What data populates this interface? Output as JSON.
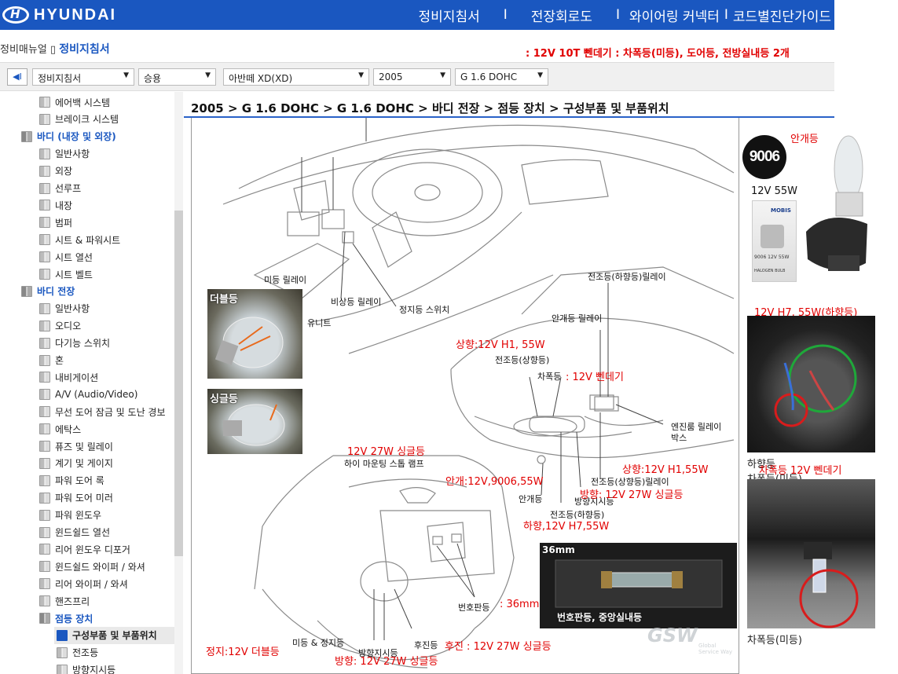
{
  "header": {
    "brand": "HYUNDAI",
    "nav": [
      "정비지침서",
      "전장회로도",
      "와이어링 커넥터",
      "코드별진단가이드"
    ],
    "separators": [
      "I",
      "I",
      "I"
    ]
  },
  "breadcrumb": {
    "prefix": "정비매뉴얼 ▯",
    "current": "정비지침서"
  },
  "notice": ": 12V 10T 뻰데기 : 차폭등(미등), 도어등, 전방실내등  2개",
  "filters": {
    "back_icon": "◀I",
    "manual": "정비지침서",
    "category": "승용",
    "model": "아반떼 XD(XD)",
    "year": "2005",
    "engine": "G 1.6 DOHC"
  },
  "sidebar": {
    "items": [
      {
        "label": "에어백 시스템",
        "level": 1
      },
      {
        "label": "브레이크 시스템",
        "level": 1
      },
      {
        "label": "바디 (내장 및 외장)",
        "level": 0
      },
      {
        "label": "일반사항",
        "level": 1
      },
      {
        "label": "외장",
        "level": 1
      },
      {
        "label": "선루프",
        "level": 1
      },
      {
        "label": "내장",
        "level": 1
      },
      {
        "label": "범퍼",
        "level": 1
      },
      {
        "label": "시트 & 파워시트",
        "level": 1
      },
      {
        "label": "시트 열선",
        "level": 1
      },
      {
        "label": "시트 벨트",
        "level": 1
      },
      {
        "label": "바디 전장",
        "level": 0
      },
      {
        "label": "일반사항",
        "level": 1
      },
      {
        "label": "오디오",
        "level": 1
      },
      {
        "label": "다기능 스위치",
        "level": 1
      },
      {
        "label": "혼",
        "level": 1
      },
      {
        "label": "내비게이션",
        "level": 1
      },
      {
        "label": "A/V (Audio/Video)",
        "level": 1
      },
      {
        "label": "무선 도어 잠금 및 도난 경보",
        "level": 1
      },
      {
        "label": "에탁스",
        "level": 1
      },
      {
        "label": "퓨즈 및 릴레이",
        "level": 1
      },
      {
        "label": "계기 및 게이지",
        "level": 1
      },
      {
        "label": "파워 도어 록",
        "level": 1
      },
      {
        "label": "파워 도어 미러",
        "level": 1
      },
      {
        "label": "파워 윈도우",
        "level": 1
      },
      {
        "label": "윈드쉴드 열선",
        "level": 1
      },
      {
        "label": "리어 윈도우 디포거",
        "level": 1
      },
      {
        "label": "윈드쉴드 와이퍼 / 와셔",
        "level": 1
      },
      {
        "label": "리어 와이퍼 / 와셔",
        "level": 1
      },
      {
        "label": "핸즈프리",
        "level": 1
      },
      {
        "label": "점등 장치",
        "level": 1,
        "open": true
      },
      {
        "label": "구성부품 및 부품위치",
        "level": 2,
        "selected": true
      },
      {
        "label": "전조등",
        "level": 2
      },
      {
        "label": "방향지시등",
        "level": 2
      }
    ]
  },
  "content": {
    "title": "2005 > G 1.6 DOHC > G 1.6 DOHC > 바디 전장 > 점등 장치 > 구성부품 및 부품위치"
  },
  "diagram_labels": {
    "taillight_relay": "미등 릴레이",
    "unit": "유니트",
    "hazard_relay": "비상등 릴레이",
    "stop_switch": "정지등 스위치",
    "headlamp_low_relay": "전조등(하향등)릴레이",
    "fog_relay": "안개등 릴레이",
    "headlamp_high": "전조등(상향등)",
    "position_lamp": "차폭등",
    "engine_relay_box": "엔진룸 릴레이\n박스",
    "headlamp_high_relay": "전조등(상향등)릴레이",
    "fog_lamp": "안개등",
    "turn_signal": "방향지시등",
    "headlamp_low": "전조등(하향등)",
    "high_mount_stop": "하이 마운팅 스톱 램프",
    "license_lamp": "번호판등",
    "tail_stop": "미등 & 정지등",
    "turn_signal_rear": "방향지시등",
    "reverse": "후진등"
  },
  "annotations": {
    "high_h1": "상향:12V H1, 55W",
    "position_wedge": ": 12V 뻰데기",
    "hmsl": "12V 27W 싱글등",
    "fog": "안개:12V,9006,55W",
    "high_h1b": "상향:12V H1,55W",
    "turn_front": "방향: 12V 27W 싱글등",
    "low_h7": "하향,12V H7,55W",
    "license": ": 36mm",
    "stop": "정지:12V 더블등",
    "turn_rear": "방향: 12V 27W 싱글등",
    "reverse": "후진 : 12V 27W 싱글등"
  },
  "photos": {
    "double": "더블등",
    "single": "싱글등",
    "license_size": "36mm",
    "license_caption": "번호판등, 중앙실내등",
    "watermark": "GSW",
    "watermark_sub": "Global\nService Way"
  },
  "right_panel": {
    "fog_title": "안개등",
    "badge": "9006",
    "fog_spec": "12V 55W",
    "box_brand": "MOBIS",
    "box_spec": "9006 12V 55W",
    "box_type": "HALOGEN BULB",
    "h7_title": "12V H7, 55W(하향등)",
    "h7_low": "하향등",
    "h7_pos": "차폭등(미등)",
    "wedge_title": "차폭등 12V 뻰데기",
    "wedge_pos": "차폭등(미등)"
  },
  "colors": {
    "brand": "#1a57c0",
    "annotation": "#e10000"
  }
}
